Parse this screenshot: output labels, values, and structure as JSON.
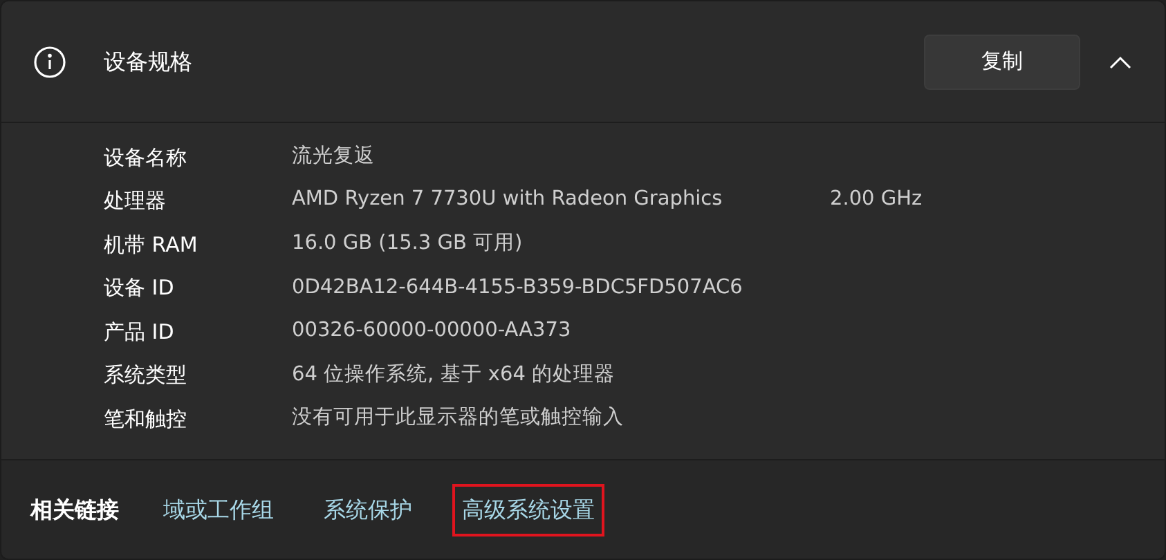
{
  "section": {
    "title": "设备规格",
    "copy_button": "复制",
    "expanded": true
  },
  "specs": [
    {
      "label": "设备名称",
      "value": "流光复返"
    },
    {
      "label": "处理器",
      "value": "AMD Ryzen 7 7730U with Radeon Graphics",
      "extra": "2.00 GHz"
    },
    {
      "label": "机带 RAM",
      "value": "16.0 GB (15.3 GB 可用)"
    },
    {
      "label": "设备 ID",
      "value": "0D42BA12-644B-4155-B359-BDC5FD507AC6"
    },
    {
      "label": "产品 ID",
      "value": "00326-60000-00000-AA373"
    },
    {
      "label": "系统类型",
      "value": "64 位操作系统, 基于 x64 的处理器"
    },
    {
      "label": "笔和触控",
      "value": "没有可用于此显示器的笔或触控输入"
    }
  ],
  "related_links": {
    "title": "相关链接",
    "links": [
      {
        "label": "域或工作组",
        "highlighted": false
      },
      {
        "label": "系统保护",
        "highlighted": false
      },
      {
        "label": "高级系统设置",
        "highlighted": true
      }
    ]
  }
}
